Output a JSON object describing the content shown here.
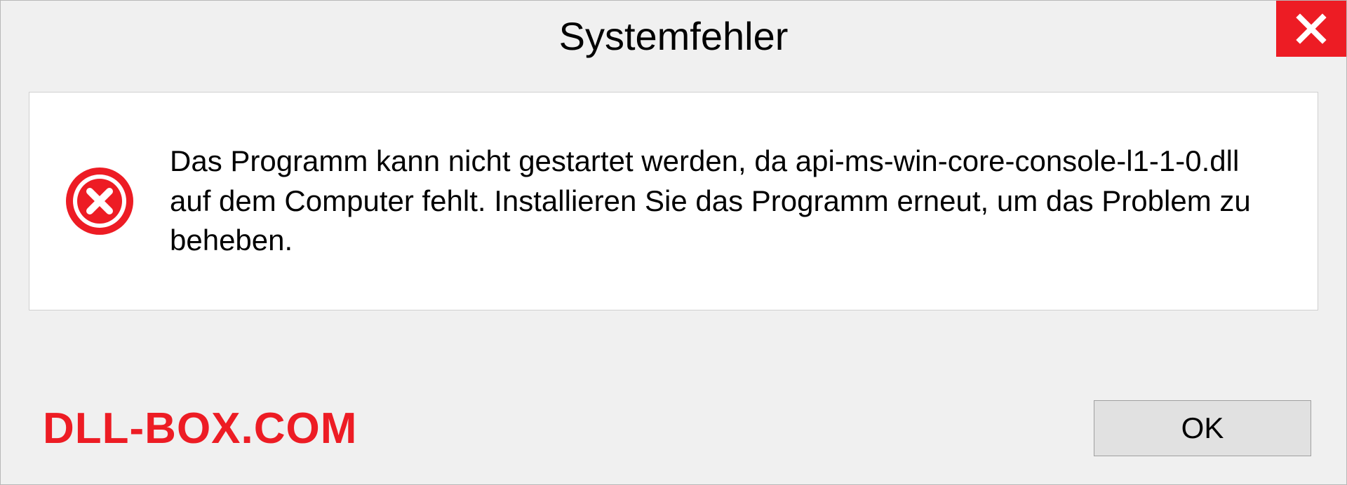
{
  "dialog": {
    "title": "Systemfehler",
    "message": "Das Programm kann nicht gestartet werden, da api-ms-win-core-console-l1-1-0.dll auf dem Computer fehlt. Installieren Sie das Programm erneut, um das Problem zu beheben.",
    "ok_label": "OK",
    "watermark": "DLL-BOX.COM"
  },
  "colors": {
    "accent_red": "#ed1c24",
    "panel_bg": "#f0f0f0",
    "content_bg": "#ffffff"
  }
}
